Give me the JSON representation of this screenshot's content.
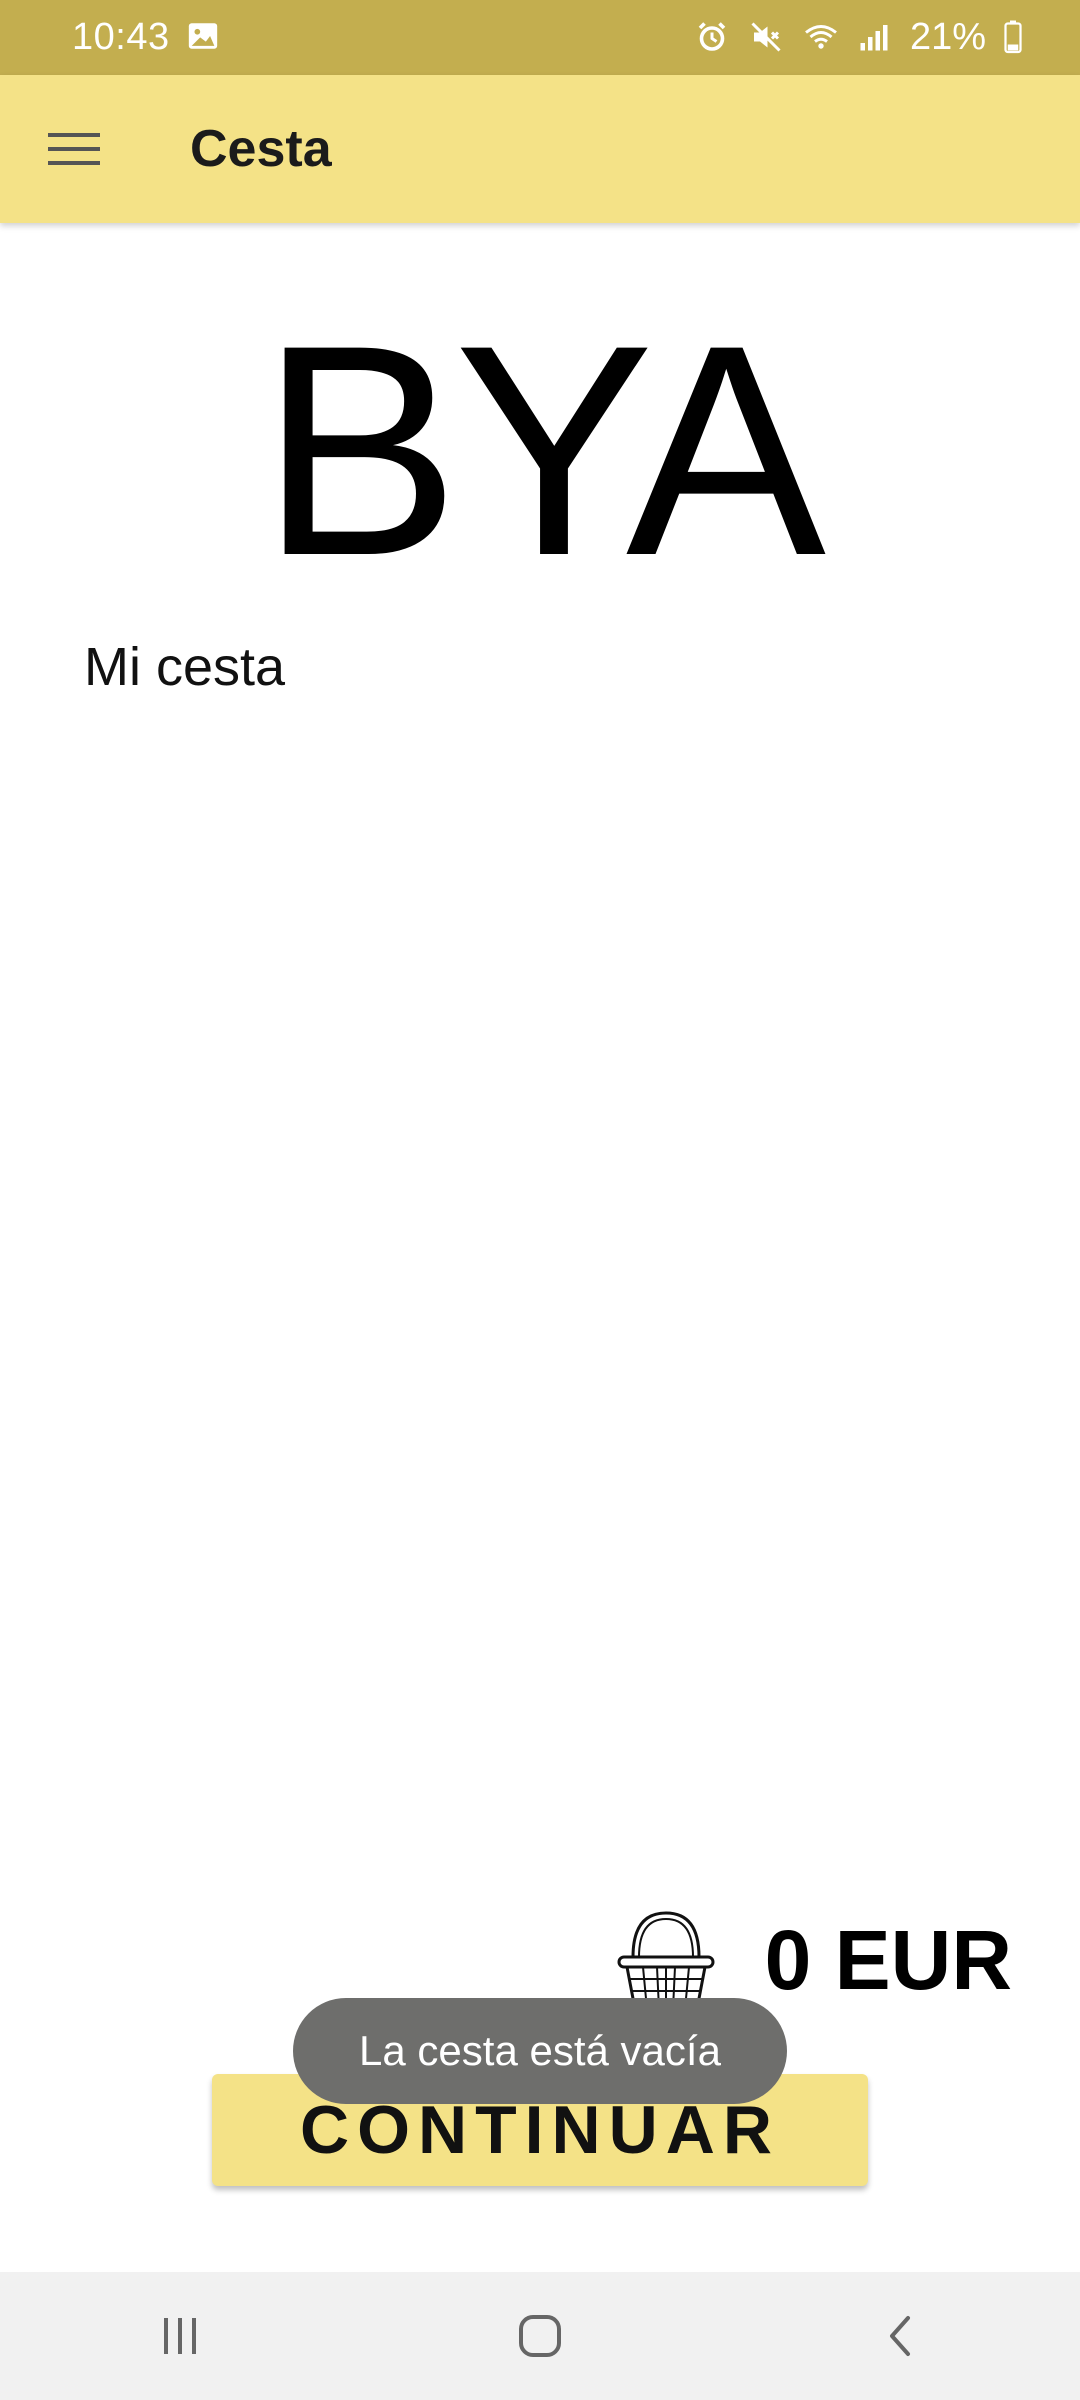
{
  "status_bar": {
    "time": "10:43",
    "battery": "21%",
    "icons": [
      "image-icon",
      "alarm-icon",
      "mute-icon",
      "wifi-icon",
      "signal-icon",
      "battery-icon"
    ]
  },
  "app_bar": {
    "title": "Cesta",
    "menu_icon": "hamburger-menu-icon"
  },
  "logo_text": "BYA",
  "section_title": "Mi cesta",
  "total": {
    "icon": "basket-icon",
    "amount": "0 EUR"
  },
  "continue_label": "CONTINUAR",
  "toast_message": "La cesta está vacía",
  "nav_bar": {
    "icons": [
      "recent-apps-icon",
      "home-icon",
      "back-icon"
    ]
  },
  "colors": {
    "status_bar": "#c3ae4f",
    "accent": "#f4e287",
    "toast": "#6e6e6c",
    "nav_bar": "#f1f1f1"
  }
}
